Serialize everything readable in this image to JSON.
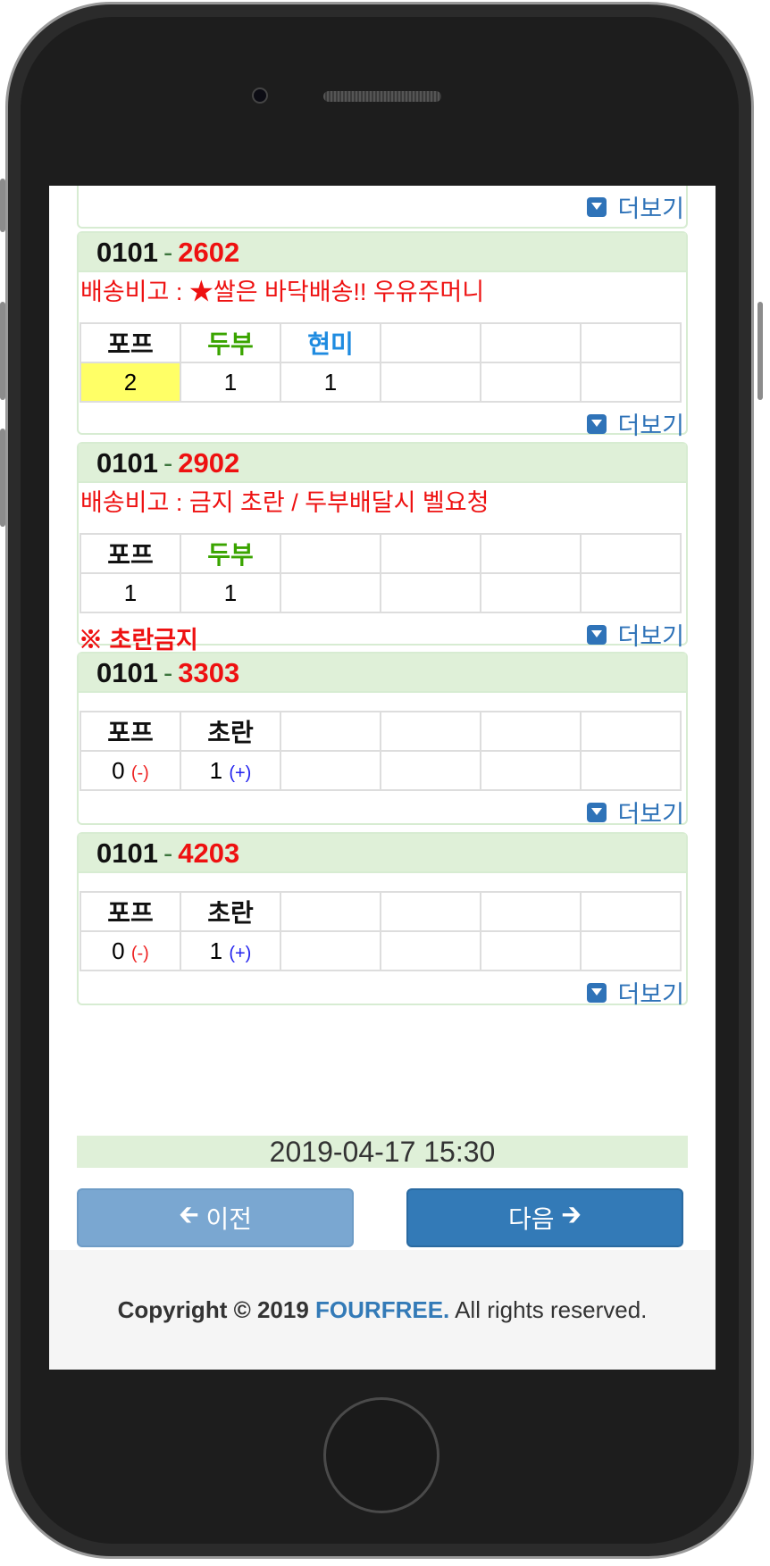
{
  "panels": [
    {
      "code": "0101",
      "sep": "-",
      "no": "2602",
      "note": "배송비고 : ★쌀은 바닥배송!! 우유주머니",
      "headers": [
        "포프",
        "두부",
        "현미",
        "",
        "",
        ""
      ],
      "values": [
        "2",
        "1",
        "1",
        "",
        "",
        ""
      ],
      "more": "더보기"
    },
    {
      "code": "0101",
      "sep": "-",
      "no": "2902",
      "note": "배송비고 : 금지 초란 / 두부배달시 벨요청",
      "headers": [
        "포프",
        "두부",
        "",
        "",
        "",
        ""
      ],
      "values": [
        "1",
        "1",
        "",
        "",
        "",
        ""
      ],
      "warning": "※ 초란금지",
      "more": "더보기"
    },
    {
      "code": "0101",
      "sep": "-",
      "no": "3303",
      "note": "",
      "headers": [
        "포프",
        "초란",
        "",
        "",
        "",
        ""
      ],
      "values": [
        "0",
        "1",
        "",
        "",
        "",
        ""
      ],
      "minus": "(-)",
      "plus": "(+)",
      "more": "더보기"
    },
    {
      "code": "0101",
      "sep": "-",
      "no": "4203",
      "note": "",
      "headers": [
        "포프",
        "초란",
        "",
        "",
        "",
        ""
      ],
      "values": [
        "0",
        "1",
        "",
        "",
        "",
        ""
      ],
      "minus": "(-)",
      "plus": "(+)",
      "more": "더보기"
    }
  ],
  "top_more": "더보기",
  "timestamp": "2019-04-17 15:30",
  "nav": {
    "prev": "이전",
    "next": "다음"
  },
  "footer": {
    "prefix": "Copyright © 2019",
    "brand": "FOURFREE.",
    "suffix": "All rights reserved."
  }
}
